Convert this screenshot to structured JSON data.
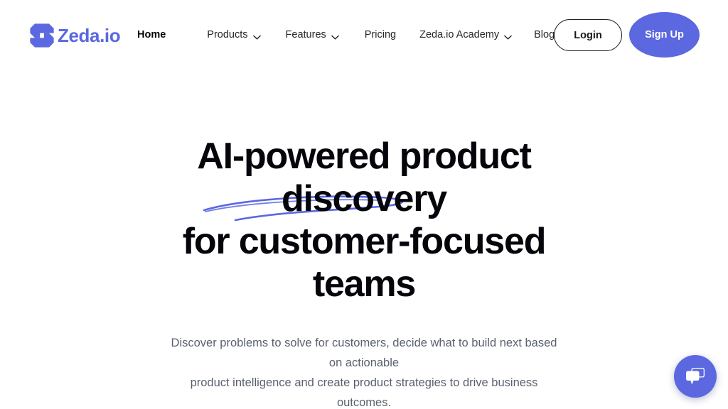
{
  "brand": {
    "logo_word": "Zeda.io",
    "logo_mark_icon": "zeda-z-arrow-logo-icon",
    "accent_color": "#5B68DF",
    "text_color": "#05060B"
  },
  "nav": {
    "items": [
      {
        "label": "Home",
        "has_dropdown": false,
        "active": true
      },
      {
        "label": "Products",
        "has_dropdown": true,
        "active": false
      },
      {
        "label": "Features",
        "has_dropdown": true,
        "active": false
      },
      {
        "label": "Pricing",
        "has_dropdown": false,
        "active": false
      },
      {
        "label": "Zeda.io Academy",
        "has_dropdown": true,
        "active": false
      },
      {
        "label": "Blog",
        "has_dropdown": false,
        "active": false
      }
    ],
    "chevron_icon": "chevron-down-icon",
    "login_label": "Login",
    "signup_label": "Sign Up",
    "signup_color": "#5B68DF"
  },
  "hero": {
    "headline_line_1": "AI-powered product",
    "headline_line_2": "discovery",
    "headline_line_3": "for customer-focused",
    "headline_line_4": "teams",
    "underline_icon": "hand-drawn-swoosh-underline-icon",
    "underline_color": "#5B68DF",
    "subheadline_line_1": "Discover problems to solve for customers, decide what to build next based on actionable",
    "subheadline_line_2": "product intelligence and create product strategies to drive business outcomes."
  },
  "chat": {
    "icon": "chat-bubbles-icon",
    "color": "#5B68DF"
  }
}
